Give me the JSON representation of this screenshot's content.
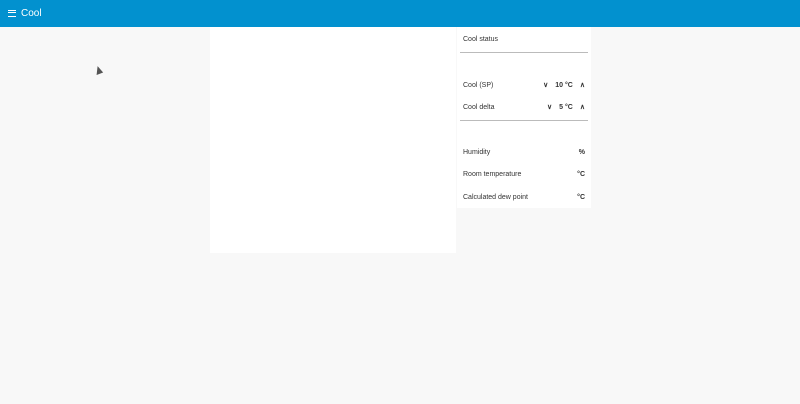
{
  "header": {
    "title": "Cool",
    "menu_icon": "menu-icon"
  },
  "panel": {
    "status_label": "Cool status",
    "setpoint": {
      "label": "Cool (SP)",
      "value": "10 °C"
    },
    "delta": {
      "label": "Cool delta",
      "value": "5 °C"
    },
    "humidity": {
      "label": "Humidity",
      "value": "%"
    },
    "room": {
      "label": "Room temperature",
      "value": "°C"
    },
    "dew": {
      "label": "Calculated dew point",
      "value": "°C"
    }
  }
}
